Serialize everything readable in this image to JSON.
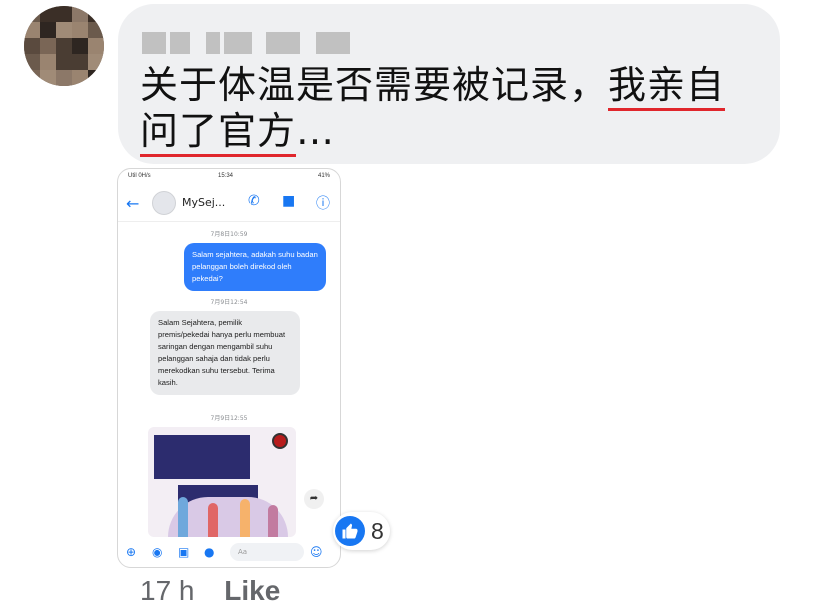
{
  "comment": {
    "author": "",
    "text_plain": "关于体温是否需要被记录，",
    "text_underlined_1": "我亲自",
    "text_underlined_2": "问了官方",
    "text_tail": "…",
    "time": "17 h",
    "like_label": "Like",
    "reaction_count": "8",
    "reaction_icon": "thumbs-up-icon",
    "underline_color": "#e0262c",
    "like_blue": "#1877f2"
  },
  "screenshot": {
    "status_left": "Util 0H/s",
    "status_time": "15:34",
    "status_right": "41%",
    "chat_title": "MySej...",
    "timestamp_1": "7月8日10:59",
    "outgoing_message": "Salam sejahtera, adakah suhu badan pelanggan boleh direkod oleh pekedai?",
    "timestamp_2": "7月9日12:54",
    "incoming_message": "Salam Sejahtera, pemilik premis/pekedai hanya perlu membuat saringan dengan mengambil suhu pelanggan sahaja dan tidak perlu merekodkan suhu tersebut. Terima kasih.",
    "timestamp_3": "7月9日12:55",
    "compose_placeholder": "Aa"
  }
}
